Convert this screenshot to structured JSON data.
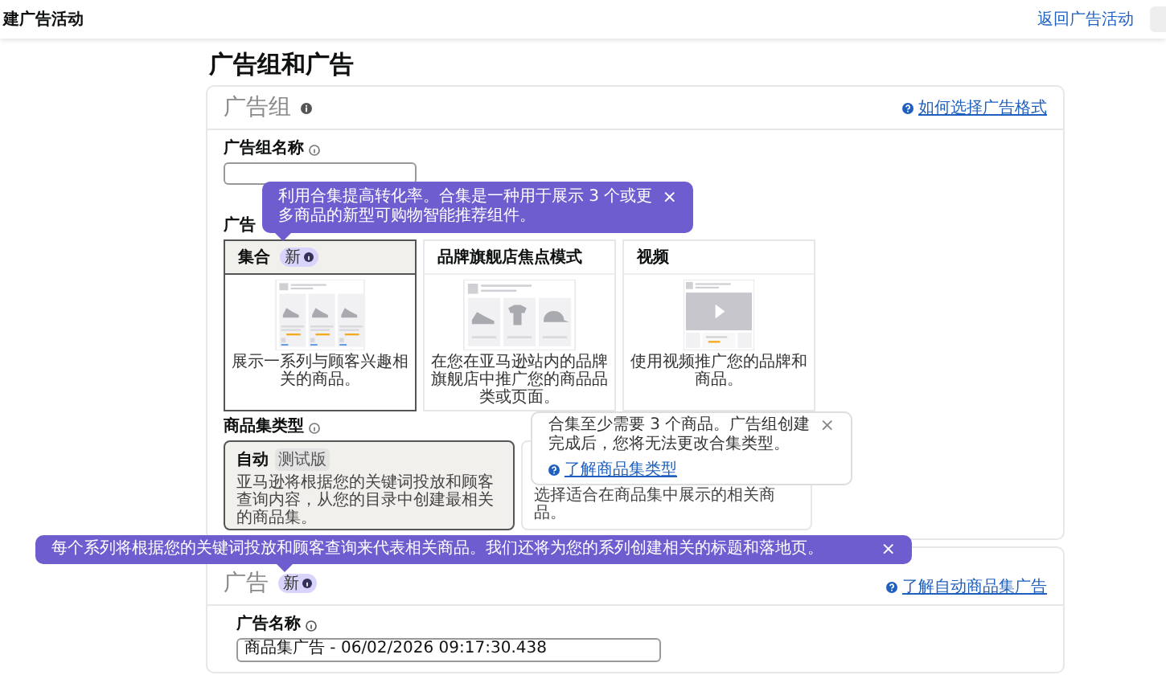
{
  "header": {
    "title": "建广告活动",
    "back_link": "返回广告活动"
  },
  "page_title": "广告组和广告",
  "ad_group": {
    "title": "广告组",
    "help_link": "如何选择广告格式",
    "name_label": "广告组名称",
    "format_label": "广告",
    "formats": [
      {
        "kind": "collection",
        "title": "集合",
        "badge": "新",
        "description": "展示一系列与顾客兴趣相关的商品。",
        "selected": true
      },
      {
        "kind": "storefront",
        "title": "品牌旗舰店焦点模式",
        "description": "在您在亚马逊站内的品牌旗舰店中推广您的商品品类或页面。",
        "selected": false
      },
      {
        "kind": "video",
        "title": "视频",
        "description": "使用视频推广您的品牌和商品。",
        "selected": false
      }
    ],
    "set_type_label": "商品集类型",
    "set_types": [
      {
        "title": "自动",
        "badge": "测试版",
        "description": "亚马逊将根据您的关键词投放和顾客查询内容，从您的目录中创建最相关的商品集。",
        "selected": true
      },
      {
        "description": "选择适合在商品集中展示的相关商品。",
        "selected": false
      }
    ]
  },
  "ad": {
    "title": "广告",
    "badge": "新",
    "help_link": "了解自动商品集广告",
    "name_label": "广告名称",
    "name_value": "商品集广告 - 06/02/2026 09:17:30.438"
  },
  "tooltips": [
    {
      "kind": "accent",
      "text": "利用合集提高转化率。合集是一种用于展示 3 个或更多商品的新型可购物智能推荐组件。",
      "close": "×"
    },
    {
      "kind": "plain",
      "text": "合集至少需要 3 个商品。广告组创建完成后，您将无法更改合集类型。",
      "link": "了解商品集类型",
      "close": "×"
    },
    {
      "kind": "accent",
      "text": "每个系列将根据您的关键词投放和顾客查询来代表相关商品。我们还将为您的系列创建相关的标题和落地页。",
      "close": "×"
    }
  ]
}
